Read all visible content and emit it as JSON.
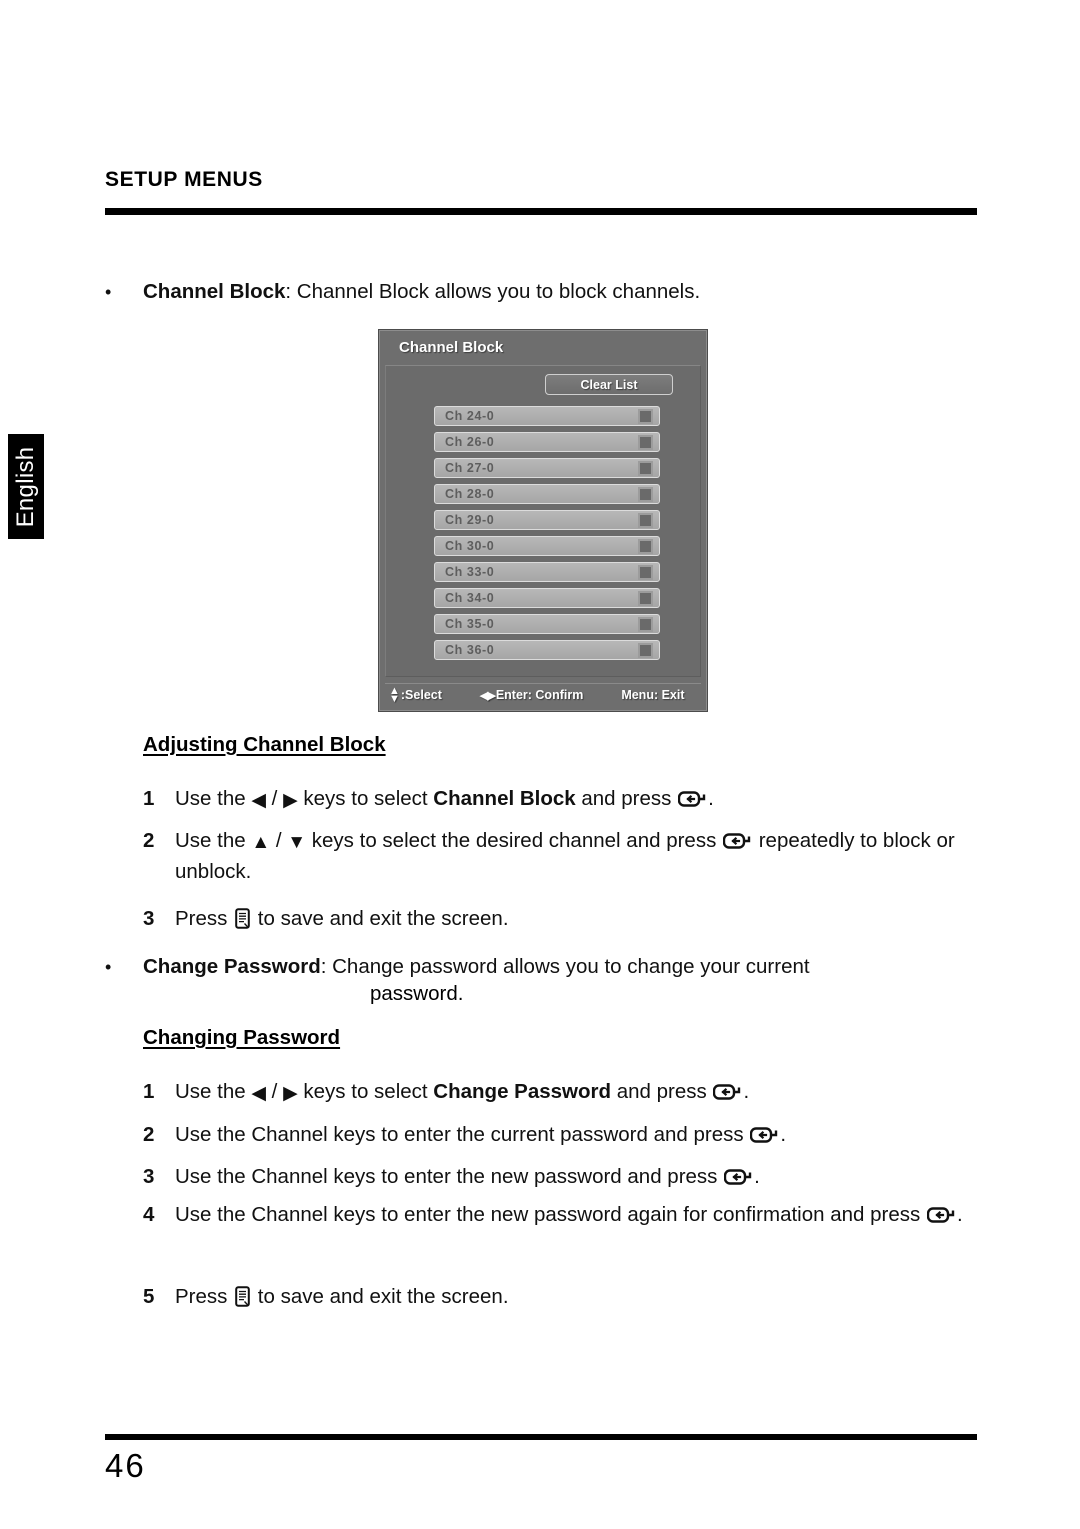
{
  "language_tab": {
    "label": "English"
  },
  "header": {
    "title": "SETUP MENUS"
  },
  "bullets": {
    "channel_block": {
      "term": "Channel Block",
      "rest": ": Channel Block allows you to block channels."
    },
    "change_password": {
      "term": "Change Password",
      "rest": ": Change password allows you to change your current",
      "rest_line2": "password."
    }
  },
  "osd": {
    "title": "Channel Block",
    "clear_button": "Clear List",
    "channels": [
      {
        "label": "Ch 24-0",
        "blocked": true
      },
      {
        "label": "Ch 26-0",
        "blocked": true
      },
      {
        "label": "Ch 27-0",
        "blocked": true
      },
      {
        "label": "Ch 28-0",
        "blocked": true
      },
      {
        "label": "Ch 29-0",
        "blocked": true
      },
      {
        "label": "Ch 30-0",
        "blocked": true
      },
      {
        "label": "Ch 33-0",
        "blocked": true
      },
      {
        "label": "Ch 34-0",
        "blocked": true
      },
      {
        "label": "Ch 35-0",
        "blocked": true
      },
      {
        "label": "Ch 36-0",
        "blocked": true
      }
    ],
    "status_bar": {
      "select": ":Select",
      "enter": "Enter: Confirm",
      "exit": "Menu: Exit"
    },
    "colors": {
      "background": "#6e6e6e",
      "panel": "#6b6b6b",
      "row": "#b0b0b0",
      "row_text": "#5e5e5e",
      "checkbox": "#6a6a6a",
      "title_text": "#ffffff"
    }
  },
  "sections": {
    "adjusting_channel_block": {
      "heading": "Adjusting Channel Block",
      "steps": [
        {
          "num": "1",
          "parts": [
            {
              "t": "text",
              "v": "Use the "
            },
            {
              "t": "icon",
              "v": "left-triangle-icon"
            },
            {
              "t": "text",
              "v": " / "
            },
            {
              "t": "icon",
              "v": "right-triangle-icon"
            },
            {
              "t": "text",
              "v": " keys to select "
            },
            {
              "t": "bold",
              "v": "Channel Block"
            },
            {
              "t": "text",
              "v": " and press "
            },
            {
              "t": "icon",
              "v": "enter-key-icon"
            },
            {
              "t": "text",
              "v": "."
            }
          ]
        },
        {
          "num": "2",
          "parts": [
            {
              "t": "text",
              "v": "Use the "
            },
            {
              "t": "icon",
              "v": "up-triangle-icon"
            },
            {
              "t": "text",
              "v": " / "
            },
            {
              "t": "icon",
              "v": "down-triangle-icon"
            },
            {
              "t": "text",
              "v": " keys to select the desired channel and press "
            },
            {
              "t": "icon",
              "v": "enter-key-icon"
            },
            {
              "t": "text",
              "v": " repeatedly to block or unblock."
            }
          ]
        },
        {
          "num": "3",
          "parts": [
            {
              "t": "text",
              "v": "Press "
            },
            {
              "t": "icon",
              "v": "menu-key-icon"
            },
            {
              "t": "text",
              "v": " to save and exit the screen."
            }
          ]
        }
      ]
    },
    "changing_password": {
      "heading": "Changing Password",
      "steps": [
        {
          "num": "1",
          "parts": [
            {
              "t": "text",
              "v": "Use the "
            },
            {
              "t": "icon",
              "v": "left-triangle-icon"
            },
            {
              "t": "text",
              "v": " / "
            },
            {
              "t": "icon",
              "v": "right-triangle-icon"
            },
            {
              "t": "text",
              "v": " keys to select "
            },
            {
              "t": "bold",
              "v": "Change Password"
            },
            {
              "t": "text",
              "v": " and press "
            },
            {
              "t": "icon",
              "v": "enter-key-icon"
            },
            {
              "t": "text",
              "v": "."
            }
          ]
        },
        {
          "num": "2",
          "parts": [
            {
              "t": "text",
              "v": "Use the Channel keys to enter the current password and press "
            },
            {
              "t": "icon",
              "v": "enter-key-icon"
            },
            {
              "t": "text",
              "v": "."
            }
          ]
        },
        {
          "num": "3",
          "parts": [
            {
              "t": "text",
              "v": "Use the Channel keys to enter the new password and press "
            },
            {
              "t": "icon",
              "v": "enter-key-icon"
            },
            {
              "t": "text",
              "v": "."
            }
          ]
        },
        {
          "num": "4",
          "parts": [
            {
              "t": "text",
              "v": "Use the Channel keys to enter the new password again for confirmation and press "
            },
            {
              "t": "icon",
              "v": "enter-key-icon"
            },
            {
              "t": "text",
              "v": "."
            }
          ]
        },
        {
          "num": "5",
          "parts": [
            {
              "t": "text",
              "v": "Press "
            },
            {
              "t": "icon",
              "v": "menu-key-icon"
            },
            {
              "t": "text",
              "v": " to save and exit the screen."
            }
          ]
        }
      ]
    }
  },
  "footer": {
    "page_number": "46"
  }
}
